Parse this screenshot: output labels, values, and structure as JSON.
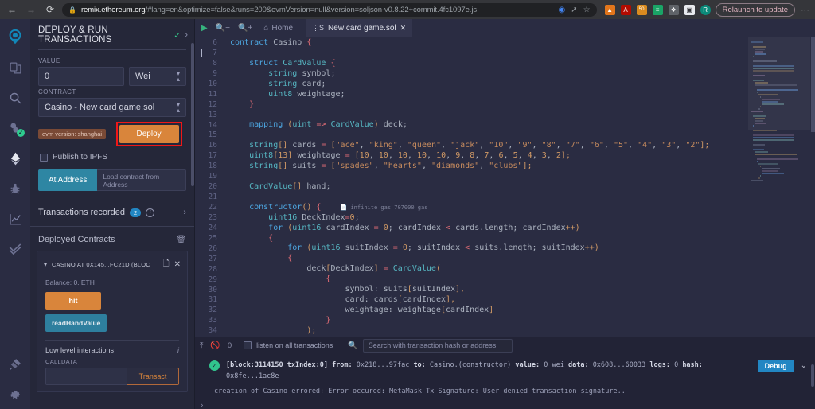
{
  "browser": {
    "back_icon": "back-arrow-icon",
    "forward_icon": "forward-arrow-icon",
    "reload_icon": "reload-icon",
    "lock_icon": "lock-icon",
    "url_host": "remix.ethereum.org",
    "url_path": "/#lang=en&optimize=false&runs=200&evmVersion=null&version=soljson-v0.8.22+commit.4fc1097e.js",
    "google_icon": "google-lens-icon",
    "share_icon": "share-icon",
    "bookmark_icon": "star-icon",
    "extensions": [
      {
        "name": "metamask-fox-extension-icon",
        "color": "#e2761b",
        "glyph": "🦊"
      },
      {
        "name": "pdf-extension-icon",
        "color": "#b30b00",
        "glyph": "A"
      },
      {
        "name": "gas-tracker-extension-icon",
        "color": "#d98b1f",
        "glyph": "50"
      },
      {
        "name": "wallet-extension-icon",
        "color": "#1aa566",
        "glyph": "≡"
      },
      {
        "name": "puzzle-extensions-icon",
        "color": "#5f6368",
        "glyph": "❖"
      },
      {
        "name": "side-panel-icon",
        "color": "#e8eaed",
        "glyph": "▣"
      },
      {
        "name": "profile-avatar",
        "color": "#0b8a7a",
        "glyph": "R"
      }
    ],
    "relaunch_label": "Relaunch to update",
    "kebab_icon": "kebab-menu-icon"
  },
  "icon_rail": [
    {
      "name": "remix-logo",
      "label": "Remix"
    },
    {
      "name": "file-explorer-icon",
      "label": "File explorer"
    },
    {
      "name": "search-icon",
      "label": "Search in files"
    },
    {
      "name": "solidity-compiler-icon",
      "label": "Solidity compiler",
      "badge": "✓"
    },
    {
      "name": "deploy-run-icon",
      "label": "Deploy & run transactions",
      "active": true
    },
    {
      "name": "debugger-bug-icon",
      "label": "Debugger"
    },
    {
      "name": "analytics-chart-icon",
      "label": "Solidity analyzers"
    },
    {
      "name": "unit-testing-check-icon",
      "label": "Solidity unit testing"
    },
    {
      "name": "plugin-manager-plug-icon",
      "label": "Plugin manager"
    },
    {
      "name": "settings-gear-icon",
      "label": "Settings"
    }
  ],
  "left_panel": {
    "title": "DEPLOY & RUN TRANSACTIONS",
    "check_glyph": "✓",
    "chevron_glyph": "›",
    "value_label": "VALUE",
    "value_amount": "0",
    "value_unit": "Wei",
    "contract_label": "CONTRACT",
    "contract_selected": "Casino - New card game.sol",
    "evm_version_badge": "evm version: shanghai",
    "deploy_label": "Deploy",
    "publish_ipfs_label": "Publish to IPFS",
    "at_address_label": "At Address",
    "load_contract_placeholder": "Load contract from Address",
    "transactions_recorded_label": "Transactions recorded",
    "transactions_recorded_count": "2",
    "deployed_contracts_label": "Deployed Contracts",
    "trash_icon": "trash-icon",
    "contract_card": {
      "caret_glyph": "⌄",
      "title": "CASINO AT 0X145...FC21D (BLOC",
      "copy_icon": "copy-icon",
      "close_glyph": "✕",
      "balance": "Balance: 0. ETH",
      "buttons": [
        {
          "name": "hit-function-button",
          "label": "hit",
          "kind": "orange"
        },
        {
          "name": "readhandvalue-function-button",
          "label": "readHandValue",
          "kind": "blue"
        }
      ],
      "low_level_label": "Low level interactions",
      "calldata_label": "CALLDATA",
      "calldata_value": "",
      "transact_label": "Transact"
    }
  },
  "editor": {
    "run_icon": "run-script-icon",
    "zoom_out_icon": "zoom-out-icon",
    "zoom_in_icon": "zoom-in-icon",
    "home_tab_label": "Home",
    "home_icon": "home-icon",
    "file_tab_label": "New card game.sol",
    "file_tab_icon": "solidity-file-icon",
    "file_tab_close_glyph": "✕",
    "first_line_number": 6,
    "gas_hint": "infinite gas 707000 gas",
    "lines": [
      "contract Casino {",
      "",
      "    struct CardValue {",
      "        string symbol;",
      "        string card;",
      "        uint8 weightage;",
      "    }",
      "",
      "    mapping (uint => CardValue) deck;",
      "",
      "    string[] cards = [\"ace\", \"king\", \"queen\", \"jack\", \"10\", \"9\", \"8\", \"7\", \"6\", \"5\", \"4\", \"3\", \"2\"];",
      "    uint8[13] weightage = [10, 10, 10, 10, 10, 9, 8, 7, 6, 5, 4, 3, 2];",
      "    string[] suits = [\"spades\", \"hearts\", \"diamonds\", \"clubs\"];",
      "",
      "    CardValue[] hand;",
      "",
      "    constructor() {",
      "        uint16 DeckIndex=0;",
      "        for (uint16 cardIndex = 0; cardIndex < cards.length; cardIndex++)",
      "        {",
      "            for (uint16 suitIndex = 0; suitIndex < suits.length; suitIndex++)",
      "            {",
      "                deck[DeckIndex] = CardValue(",
      "                    {",
      "                        symbol: suits[suitIndex],",
      "                        card: cards[cardIndex],",
      "                        weightage: weightage[cardIndex]",
      "                    }",
      "                );"
    ]
  },
  "terminal": {
    "clear_icon": "clear-console-icon",
    "block_icon": "no-entry-icon",
    "count": "0",
    "listen_label": "listen on all transactions",
    "search_icon": "search-icon",
    "search_placeholder": "Search with transaction hash or address",
    "log": {
      "status_glyph": "✓",
      "block_label": "[block:3114150 txIndex:0]",
      "from_key": "from:",
      "from_value": "0x218...97fac",
      "to_key": "to:",
      "to_value": "Casino.(constructor)",
      "value_key": "value:",
      "value_value": "0 wei",
      "data_key": "data:",
      "data_value": "0x608...60033",
      "logs_key": "logs:",
      "logs_value": "0",
      "hash_key": "hash:",
      "hash_value": "0x8fe...1ac8e",
      "debug_label": "Debug",
      "caret_glyph": "⌄"
    },
    "error_line": "creation of Casino errored: Error occured: MetaMask Tx Signature: User denied transaction signature..",
    "prompt_glyph": "›"
  },
  "colors": {
    "accent_orange": "#d9853b",
    "accent_blue": "#2286c3",
    "success_green": "#31c48d",
    "highlight_red": "#f01717",
    "panel_bg": "#252739",
    "editor_bg": "#2a2c42"
  }
}
